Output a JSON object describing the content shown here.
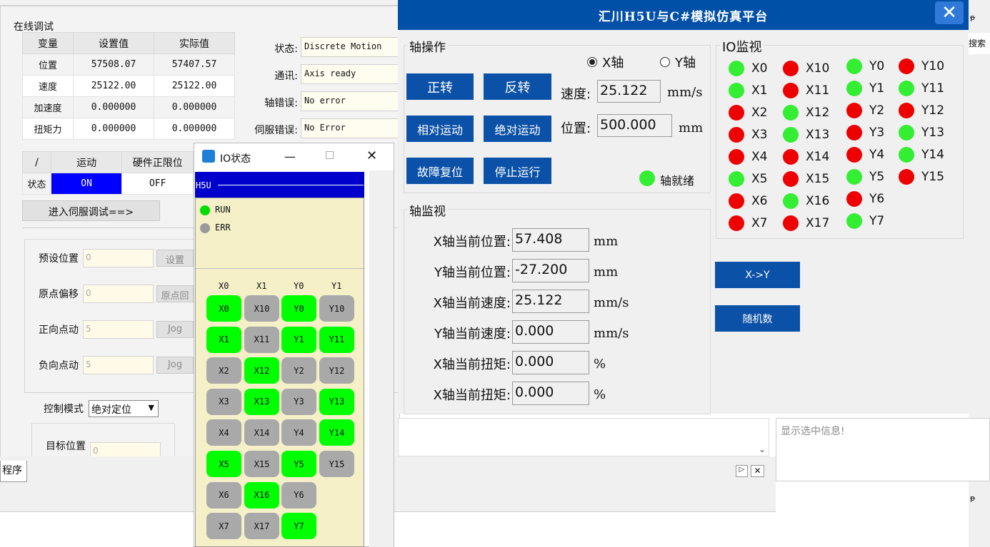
{
  "online_debug": {
    "title": "在线调试",
    "table_headers": [
      "变量",
      "设置值",
      "实际值"
    ],
    "rows": [
      {
        "name": "位置",
        "set": "57508.07",
        "actual": "57407.57"
      },
      {
        "name": "速度",
        "set": "25122.00",
        "actual": "25122.00"
      },
      {
        "name": "加速度",
        "set": "0.000000",
        "actual": "0.000000"
      },
      {
        "name": "扭矩力",
        "set": "0.000000",
        "actual": "0.000000"
      }
    ],
    "status_fields": [
      {
        "label": "状态:",
        "value": "Discrete Motion"
      },
      {
        "label": "通讯:",
        "value": "Axis ready"
      },
      {
        "label": "轴错误:",
        "value": "No error"
      },
      {
        "label": "伺服错误:",
        "value": "No Error"
      }
    ],
    "motion_headers": [
      "/",
      "运动",
      "硬件正限位"
    ],
    "motion_row": {
      "label": "状态",
      "motion": "ON",
      "limit": "OFF"
    },
    "servo_button": "进入伺服调试==>",
    "preset_rows": [
      {
        "label": "预设位置",
        "value": "0",
        "button": "设置"
      },
      {
        "label": "原点偏移",
        "value": "0",
        "button": "原点回"
      },
      {
        "label": "正向点动",
        "value": "5",
        "button": "Jog"
      },
      {
        "label": "负向点动",
        "value": "5",
        "button": "Jog"
      }
    ],
    "control_mode_label": "控制模式",
    "control_mode_value": "绝对定位",
    "target_label": "目标位置",
    "target_value": "0",
    "program_tab": "程序"
  },
  "io_window": {
    "title": "IO状态",
    "blue_label": "H5U",
    "run": "RUN",
    "err": "ERR",
    "col_headers": [
      "X0",
      "X1",
      "Y0",
      "Y1"
    ],
    "grid": [
      [
        {
          "l": "X0",
          "on": true
        },
        {
          "l": "X10",
          "on": false
        },
        {
          "l": "Y0",
          "on": true
        },
        {
          "l": "Y10",
          "on": false
        }
      ],
      [
        {
          "l": "X1",
          "on": true
        },
        {
          "l": "X11",
          "on": false
        },
        {
          "l": "Y1",
          "on": true
        },
        {
          "l": "Y11",
          "on": true
        }
      ],
      [
        {
          "l": "X2",
          "on": false
        },
        {
          "l": "X12",
          "on": true
        },
        {
          "l": "Y2",
          "on": false
        },
        {
          "l": "Y12",
          "on": false
        }
      ],
      [
        {
          "l": "X3",
          "on": false
        },
        {
          "l": "X13",
          "on": true
        },
        {
          "l": "Y3",
          "on": false
        },
        {
          "l": "Y13",
          "on": true
        }
      ],
      [
        {
          "l": "X4",
          "on": false
        },
        {
          "l": "X14",
          "on": false
        },
        {
          "l": "Y4",
          "on": false
        },
        {
          "l": "Y14",
          "on": true
        }
      ],
      [
        {
          "l": "X5",
          "on": true
        },
        {
          "l": "X15",
          "on": false
        },
        {
          "l": "Y5",
          "on": true
        },
        {
          "l": "Y15",
          "on": false
        }
      ],
      [
        {
          "l": "X6",
          "on": false
        },
        {
          "l": "X16",
          "on": true
        },
        {
          "l": "Y6",
          "on": false
        }
      ],
      [
        {
          "l": "X7",
          "on": false
        },
        {
          "l": "X17",
          "on": false
        },
        {
          "l": "Y7",
          "on": true
        }
      ]
    ]
  },
  "main": {
    "title": "汇川H5U与C#模拟仿真平台",
    "axis_op": {
      "title": "轴操作",
      "radio_x": "X轴",
      "radio_y": "Y轴",
      "buttons": [
        "正转",
        "反转",
        "相对运动",
        "绝对运动",
        "故障复位",
        "停止运行"
      ],
      "speed_label": "速度:",
      "speed_value": "25.122",
      "speed_unit": "mm/s",
      "pos_label": "位置:",
      "pos_value": "500.000",
      "pos_unit": "mm",
      "ready_label": "轴就绪"
    },
    "axis_monitor": {
      "title": "轴监视",
      "rows": [
        {
          "label": "X轴当前位置:",
          "value": "57.408",
          "unit": "mm"
        },
        {
          "label": "Y轴当前位置:",
          "value": "-27.200",
          "unit": "mm"
        },
        {
          "label": "X轴当前速度:",
          "value": "25.122",
          "unit": "mm/s"
        },
        {
          "label": "Y轴当前速度:",
          "value": "0.000",
          "unit": "mm/s"
        },
        {
          "label": "X轴当前扭矩:",
          "value": "0.000",
          "unit": "%"
        },
        {
          "label": "X轴当前扭矩:",
          "value": "0.000",
          "unit": "%"
        }
      ]
    },
    "io_monitor": {
      "title": "IO监视",
      "x_low": [
        {
          "l": "X0",
          "c": "green"
        },
        {
          "l": "X1",
          "c": "green"
        },
        {
          "l": "X2",
          "c": "red"
        },
        {
          "l": "X3",
          "c": "red"
        },
        {
          "l": "X4",
          "c": "red"
        },
        {
          "l": "X5",
          "c": "green"
        },
        {
          "l": "X6",
          "c": "red"
        },
        {
          "l": "X7",
          "c": "red"
        }
      ],
      "x_high": [
        {
          "l": "X10",
          "c": "red"
        },
        {
          "l": "X11",
          "c": "red"
        },
        {
          "l": "X12",
          "c": "green"
        },
        {
          "l": "X13",
          "c": "green"
        },
        {
          "l": "X14",
          "c": "red"
        },
        {
          "l": "X15",
          "c": "red"
        },
        {
          "l": "X16",
          "c": "green"
        },
        {
          "l": "X17",
          "c": "red"
        }
      ],
      "y_low": [
        {
          "l": "Y0",
          "c": "green"
        },
        {
          "l": "Y1",
          "c": "green"
        },
        {
          "l": "Y2",
          "c": "red"
        },
        {
          "l": "Y3",
          "c": "red"
        },
        {
          "l": "Y4",
          "c": "red"
        },
        {
          "l": "Y5",
          "c": "green"
        },
        {
          "l": "Y6",
          "c": "red"
        },
        {
          "l": "Y7",
          "c": "green"
        }
      ],
      "y_high": [
        {
          "l": "Y10",
          "c": "red"
        },
        {
          "l": "Y11",
          "c": "green"
        },
        {
          "l": "Y12",
          "c": "red"
        },
        {
          "l": "Y13",
          "c": "green"
        },
        {
          "l": "Y14",
          "c": "green"
        },
        {
          "l": "Y15",
          "c": "red"
        }
      ]
    },
    "xy_button": "X->Y",
    "random_button": "随机数"
  },
  "right_panel": {
    "search_label": "搜索",
    "info_placeholder": "显示选中信息!"
  },
  "colors": {
    "title_blue": "#0050a8",
    "button_blue": "#0b51a7",
    "led_green": "#33ee33",
    "led_red": "#ee0000",
    "io_on": "#00ff00",
    "io_off": "#a9a9a9"
  }
}
